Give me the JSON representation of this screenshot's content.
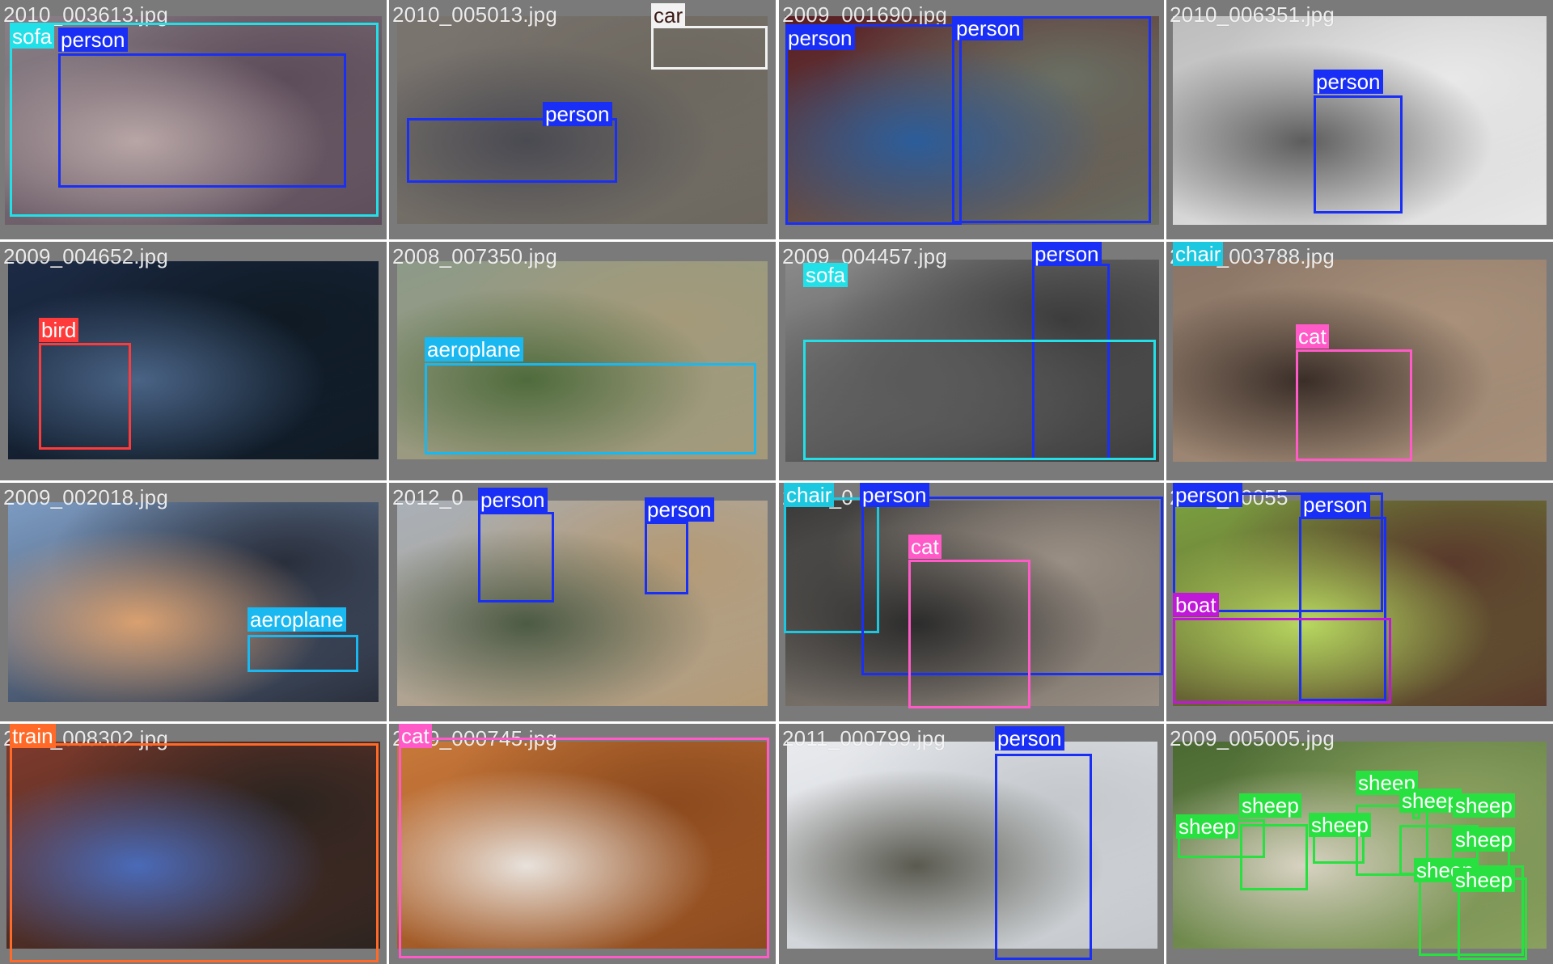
{
  "colors": {
    "person": "#1a2ff5",
    "sofa": "#22e0e8",
    "car": "#ffffff",
    "bird": "#ff3a3a",
    "aeroplane": "#1ab8f0",
    "chair": "#1cc8e0",
    "cat": "#ff5ac8",
    "boat": "#c018d8",
    "train": "#ff6a28",
    "sheep": "#28e040",
    "tile_background": "#7a7a7a",
    "grid_gap": "#ffffff"
  },
  "tiles": [
    {
      "filename": "2010_003613.jpg",
      "scene_colors": [
        "#8a7f86",
        "#b8a6a6",
        "#5d4c5a"
      ],
      "boxes": [
        {
          "label": "sofa",
          "color": "#22e0e8"
        },
        {
          "label": "person",
          "color": "#1a2ff5"
        }
      ]
    },
    {
      "filename": "2010_005013.jpg",
      "scene_colors": [
        "#7b7570",
        "#4a4a52",
        "#6d685f"
      ],
      "boxes": [
        {
          "label": "car",
          "color": "#f2f2f2",
          "label_color": "#3b1a14"
        },
        {
          "label": "person",
          "color": "#1a2ff5"
        }
      ]
    },
    {
      "filename": "2009_001690.jpg",
      "scene_colors": [
        "#5a1d22",
        "#2c5d9a",
        "#6a6f63"
      ],
      "boxes": [
        {
          "label": "person",
          "color": "#1a2ff5"
        },
        {
          "label": "person",
          "color": "#1a2ff5"
        }
      ]
    },
    {
      "filename": "2010_006351.jpg",
      "scene_colors": [
        "#bdbdbd",
        "#5d5d5d",
        "#e8e8e8"
      ],
      "boxes": [
        {
          "label": "person",
          "color": "#1a2ff5"
        }
      ]
    },
    {
      "filename": "2009_004652.jpg",
      "scene_colors": [
        "#1c2a44",
        "#4a6486",
        "#0f1a24"
      ],
      "boxes": [
        {
          "label": "bird",
          "color": "#ff3a3a"
        }
      ]
    },
    {
      "filename": "2008_007350.jpg",
      "scene_colors": [
        "#8d9a88",
        "#4f6b3c",
        "#a49a7a"
      ],
      "boxes": [
        {
          "label": "aeroplane",
          "color": "#1ab8f0"
        }
      ]
    },
    {
      "filename": "2009_004457.jpg",
      "scene_colors": [
        "#8a8a8a",
        "#5a5a5a",
        "#3c3c3c"
      ],
      "boxes": [
        {
          "label": "person",
          "color": "#1a2ff5"
        },
        {
          "label": "sofa",
          "color": "#22e0e8"
        }
      ]
    },
    {
      "filename": "2007_003788.jpg",
      "scene_colors": [
        "#8a7566",
        "#3a2e28",
        "#a8907a"
      ],
      "boxes": [
        {
          "label": "chair",
          "color": "#1cc8e0"
        },
        {
          "label": "cat",
          "color": "#ff5ac8"
        }
      ]
    },
    {
      "filename": "2009_002018.jpg",
      "scene_colors": [
        "#7c9bc2",
        "#d9a070",
        "#2a2f3c"
      ],
      "boxes": [
        {
          "label": "aeroplane",
          "color": "#1ab8f0"
        }
      ]
    },
    {
      "filename": "2012_0",
      "scene_colors": [
        "#a9b0b8",
        "#4c5a44",
        "#b49a76"
      ],
      "boxes": [
        {
          "label": "person",
          "color": "#1a2ff5"
        },
        {
          "label": "person",
          "color": "#1a2ff5"
        }
      ]
    },
    {
      "filename": "2009_0",
      "scene_colors": [
        "#3a3a3a",
        "#2c2c2c",
        "#9a8f84"
      ],
      "boxes": [
        {
          "label": "chair",
          "color": "#1cc8e0"
        },
        {
          "label": "person",
          "color": "#1a2ff5"
        },
        {
          "label": "cat",
          "color": "#ff5ac8"
        }
      ]
    },
    {
      "filename": "2010_00055",
      "scene_colors": [
        "#7aa040",
        "#b8d860",
        "#5a3a2c"
      ],
      "boxes": [
        {
          "label": "person",
          "color": "#1a2ff5"
        },
        {
          "label": "person",
          "color": "#1a2ff5"
        },
        {
          "label": "boat",
          "color": "#c018d8"
        }
      ]
    },
    {
      "filename": "2008_008302.jpg",
      "scene_colors": [
        "#7e3a2c",
        "#4a6ab8",
        "#2c2420"
      ],
      "boxes": [
        {
          "label": "train",
          "color": "#ff6a28"
        }
      ]
    },
    {
      "filename": "2009_000745.jpg",
      "scene_colors": [
        "#c8783a",
        "#e8e2dc",
        "#8c4a1e"
      ],
      "boxes": [
        {
          "label": "cat",
          "color": "#ff5ac8"
        }
      ]
    },
    {
      "filename": "2011_000799.jpg",
      "scene_colors": [
        "#e8eaee",
        "#5a5a50",
        "#c4c8cc"
      ],
      "boxes": [
        {
          "label": "person",
          "color": "#1a2ff5"
        }
      ]
    },
    {
      "filename": "2009_005005.jpg",
      "scene_colors": [
        "#4a6a32",
        "#d8d2c2",
        "#8aa060"
      ],
      "boxes": [
        {
          "label": "sheep",
          "color": "#28e040"
        },
        {
          "label": "sheep",
          "color": "#28e040"
        },
        {
          "label": "sheep",
          "color": "#28e040"
        },
        {
          "label": "sheep",
          "color": "#28e040"
        },
        {
          "label": "sheep",
          "color": "#28e040"
        },
        {
          "label": "sheep",
          "color": "#28e040"
        },
        {
          "label": "sheep",
          "color": "#28e040"
        },
        {
          "label": "sheep",
          "color": "#28e040"
        },
        {
          "label": "sheep",
          "color": "#28e040"
        }
      ]
    }
  ]
}
